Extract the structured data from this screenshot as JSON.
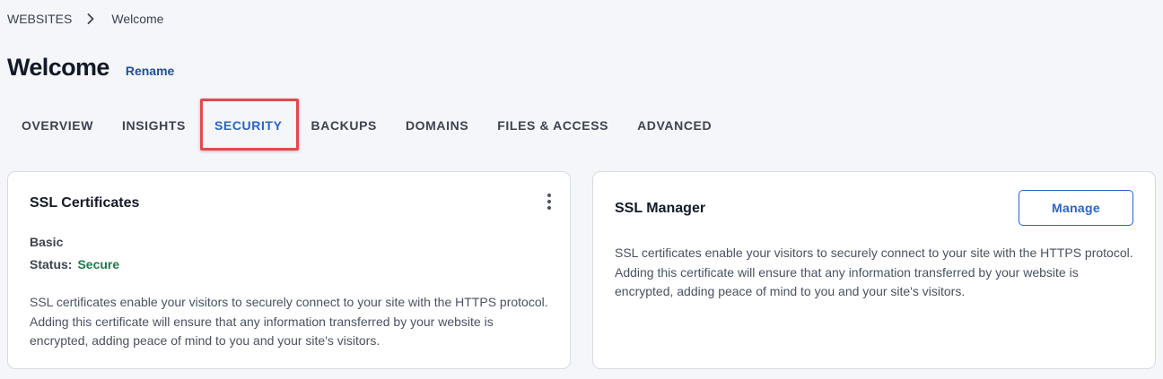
{
  "breadcrumb": {
    "root": "WEBSITES",
    "separator_icon": "chevron-right-icon",
    "current": "Welcome"
  },
  "header": {
    "title": "Welcome",
    "rename_label": "Rename"
  },
  "tabs": [
    {
      "label": "OVERVIEW",
      "active": false
    },
    {
      "label": "INSIGHTS",
      "active": false
    },
    {
      "label": "SECURITY",
      "active": true
    },
    {
      "label": "BACKUPS",
      "active": false
    },
    {
      "label": "DOMAINS",
      "active": false
    },
    {
      "label": "FILES & ACCESS",
      "active": false
    },
    {
      "label": "ADVANCED",
      "active": false
    }
  ],
  "ssl_certificates": {
    "title": "SSL Certificates",
    "menu_icon": "more-vertical-icon",
    "plan": "Basic",
    "status_label": "Status:",
    "status_value": "Secure",
    "description": "SSL certificates enable your visitors to securely connect to your site with the HTTPS protocol. Adding this certificate will ensure that any information transferred by your website is encrypted, adding peace of mind to you and your site's visitors."
  },
  "ssl_manager": {
    "title": "SSL Manager",
    "manage_label": "Manage",
    "description": "SSL certificates enable your visitors to securely connect to your site with the HTTPS protocol. Adding this certificate will ensure that any information transferred by your website is encrypted, adding peace of mind to you and your site's visitors."
  },
  "colors": {
    "accent": "#2a64c9",
    "status_secure": "#1f7a4d",
    "highlight": "#e5484d"
  }
}
